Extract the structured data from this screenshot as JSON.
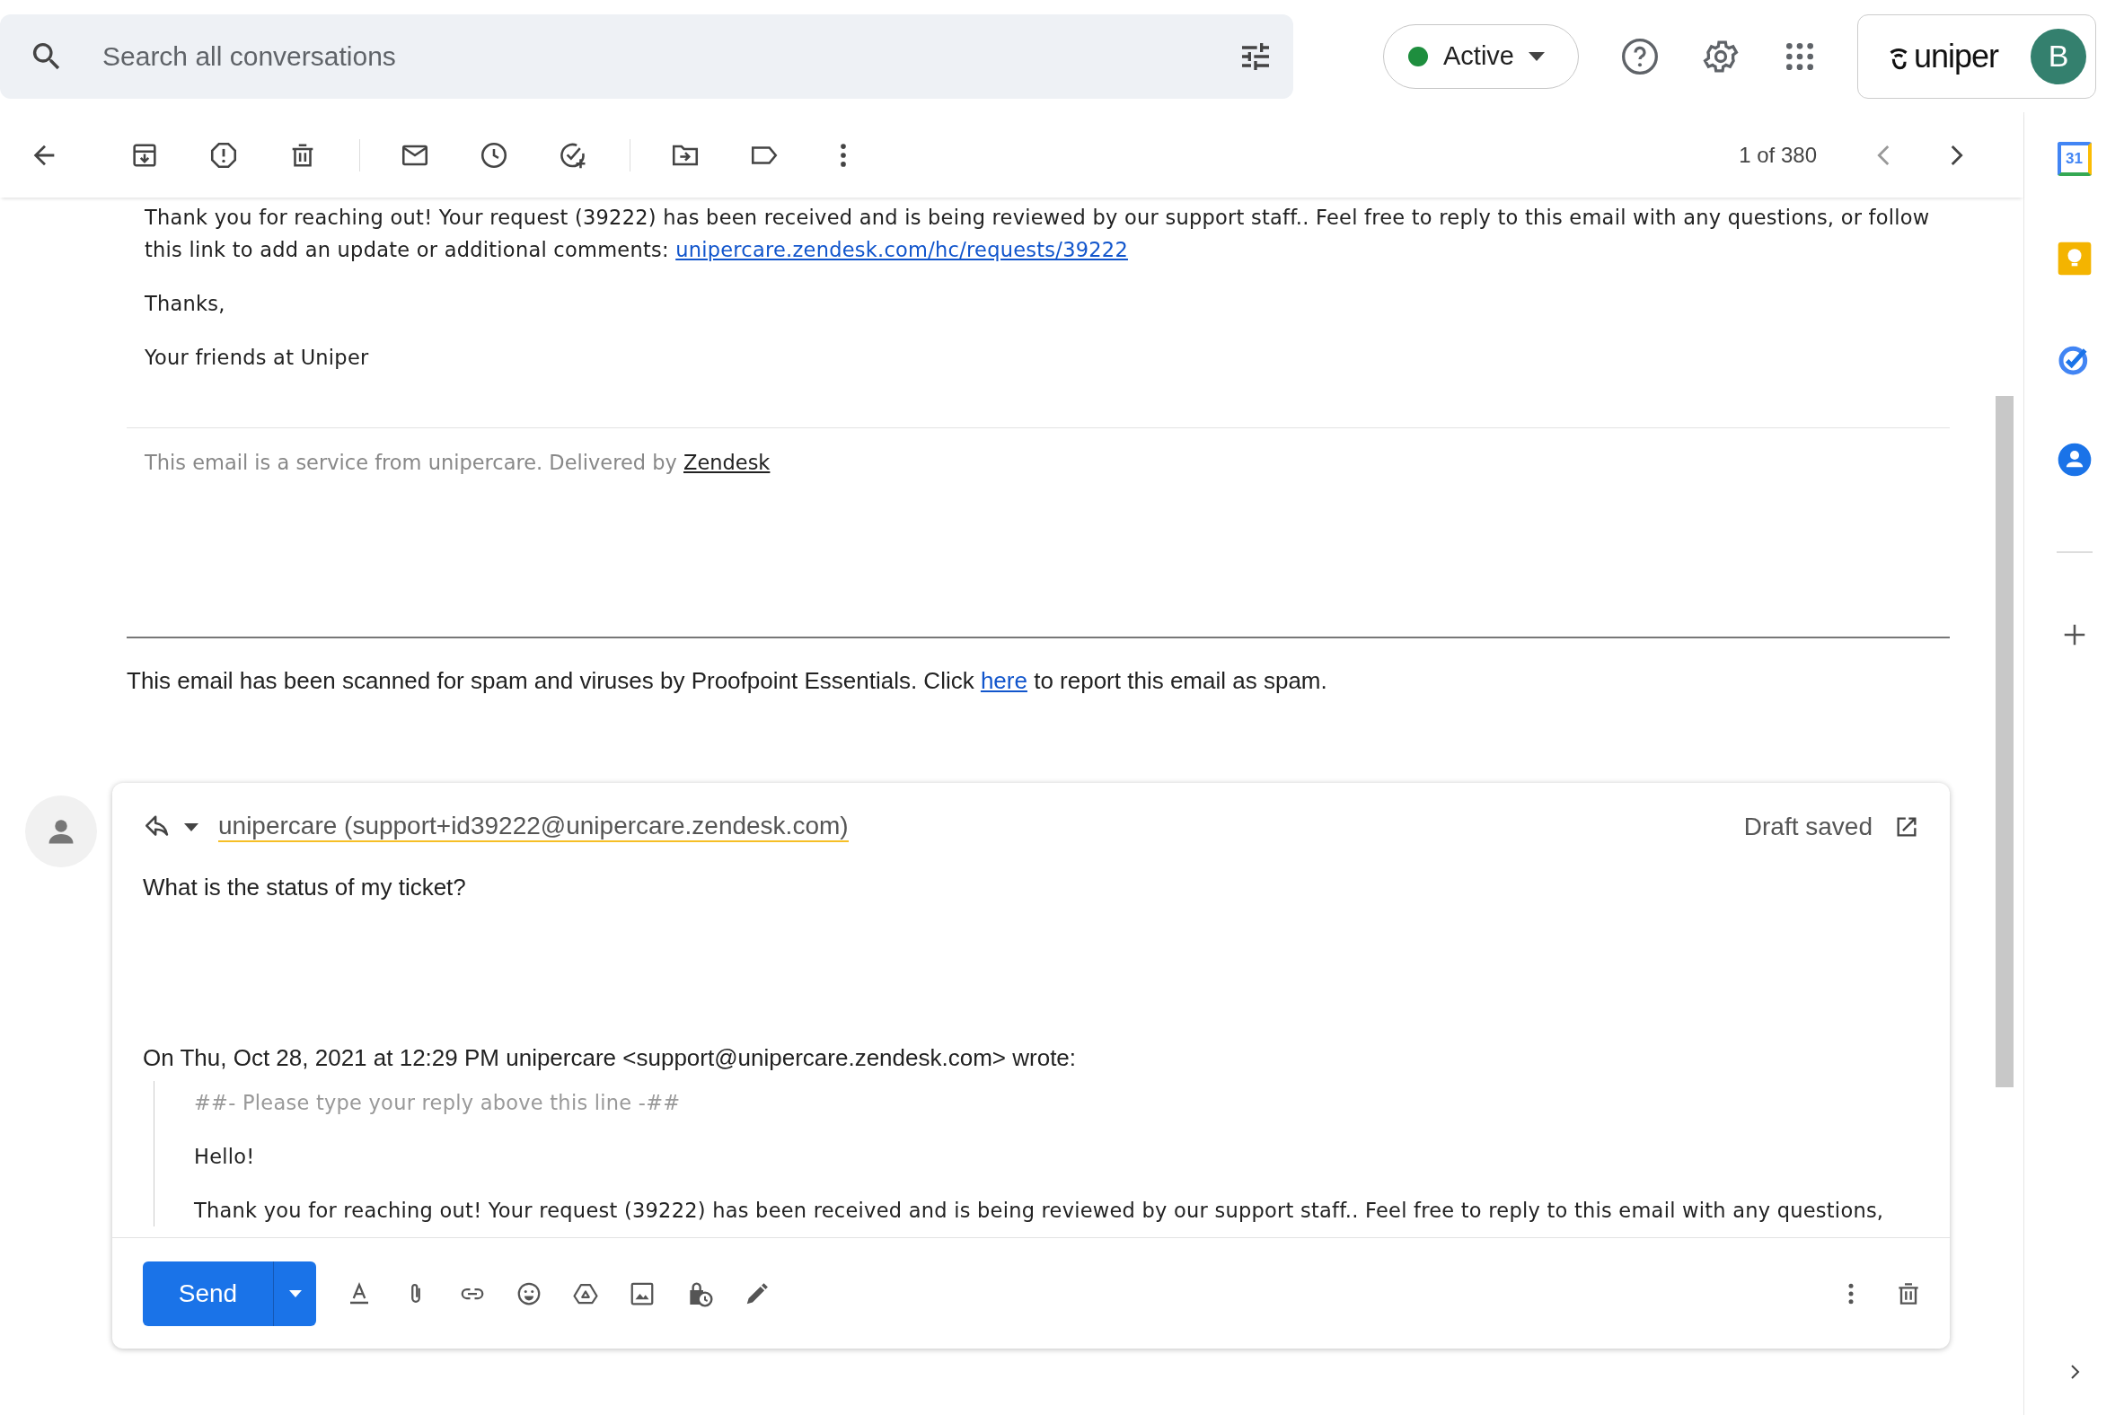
{
  "search": {
    "placeholder": "Search all conversations"
  },
  "status": {
    "label": "Active"
  },
  "account": {
    "logo": "uniper",
    "initial": "B"
  },
  "toolbar": {
    "counter": "1 of 380"
  },
  "message": {
    "intro": {
      "text": "Thank you for reaching out! Your request (39222) has been received and is being reviewed by our support staff.. Feel free to reply to this email with any questions, or follow this link to add an update or additional comments: ",
      "link": "unipercare.zendesk.com/hc/requests/39222"
    },
    "closing": [
      "Thanks,",
      "Your friends at Uniper"
    ],
    "footer": {
      "text": "This email is a service from unipercare. Delivered by ",
      "link": "Zendesk"
    }
  },
  "scan_notice": {
    "before": "This email has been scanned for spam and viruses by Proofpoint Essentials. Click ",
    "link": "here",
    "after": " to report this email as spam."
  },
  "compose": {
    "recipient": "unipercare (support+id39222@unipercare.zendesk.com)",
    "draft_status": "Draft saved",
    "body": "What is the status of my ticket?",
    "quote_header": "On Thu, Oct 28, 2021 at 12:29 PM unipercare <support@unipercare.zendesk.com> wrote:",
    "quoted": [
      {
        "kind": "separator",
        "text": "##- Please type your reply above this line -##"
      },
      {
        "kind": "text",
        "text": "Hello!"
      },
      {
        "kind": "text",
        "text": "Thank you for reaching out! Your request (39222) has been received and is being reviewed by our support staff.. Feel free to reply to this email with any questions,"
      }
    ],
    "send": "Send"
  },
  "side_panel": {
    "calendar_day": "31"
  }
}
